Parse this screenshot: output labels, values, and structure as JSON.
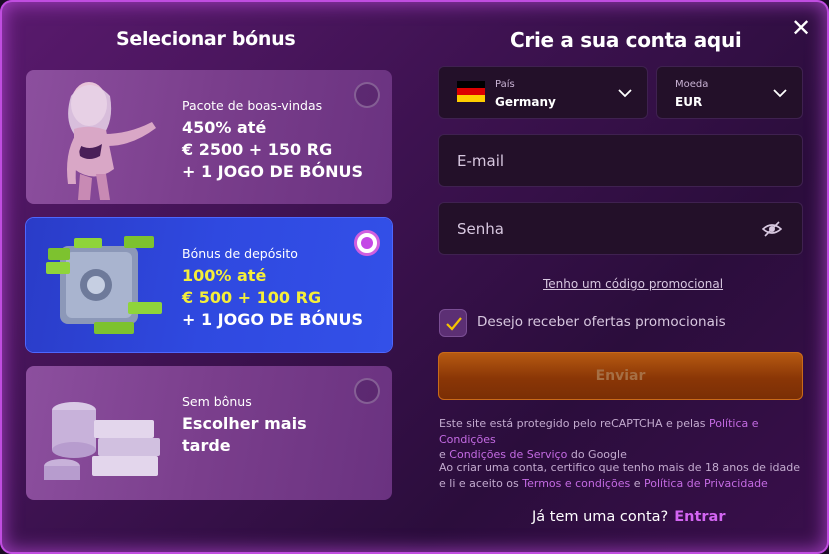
{
  "close_label": "✕",
  "left_title": "Selecionar bónus",
  "right_title": "Crie a sua conta aqui",
  "bonuses": [
    {
      "label": "Pacote de boas-vindas",
      "lines": [
        "450% até",
        "€ 2500 + 150 RG",
        "+ 1 JOGO DE BÓNUS"
      ],
      "selected": false
    },
    {
      "label": "Bónus de depósito",
      "lines": [
        "100% até",
        "€ 500 + 100 RG",
        "+ 1 JOGO DE BÓNUS"
      ],
      "selected": true
    },
    {
      "label": "Sem bônus",
      "lines": [
        "Escolher mais",
        "tarde"
      ],
      "selected": false
    }
  ],
  "form": {
    "country_label": "País",
    "country_value": "Germany",
    "currency_label": "Moeda",
    "currency_value": "EUR",
    "email_placeholder": "E-mail",
    "password_placeholder": "Senha",
    "promo_link": "Tenho um código promocional",
    "offers_label": "Desejo receber ofertas promocionais",
    "offers_checked": true,
    "submit_label": "Enviar"
  },
  "legal": {
    "recaptcha_prefix": "Este site está protegido pelo reCAPTCHA e pelas",
    "privacy_link": "Política e Condições",
    "and": "e",
    "terms_service_link": "Condições de Serviço",
    "recaptcha_suffix": "do Google",
    "age_prefix": "Ao criar uma conta, certifico que tenho mais de 18 anos de idade e li e aceito os",
    "terms_link": "Termos e condições",
    "privacy_policy_link": "Política de Privacidade"
  },
  "login": {
    "prompt": "Já tem uma conta?",
    "link": "Entrar"
  },
  "colors": {
    "accent": "#c448e6",
    "selected_card": "#2f49e0",
    "highlight_text": "#f4ee3a",
    "submit": "#8a3606"
  }
}
